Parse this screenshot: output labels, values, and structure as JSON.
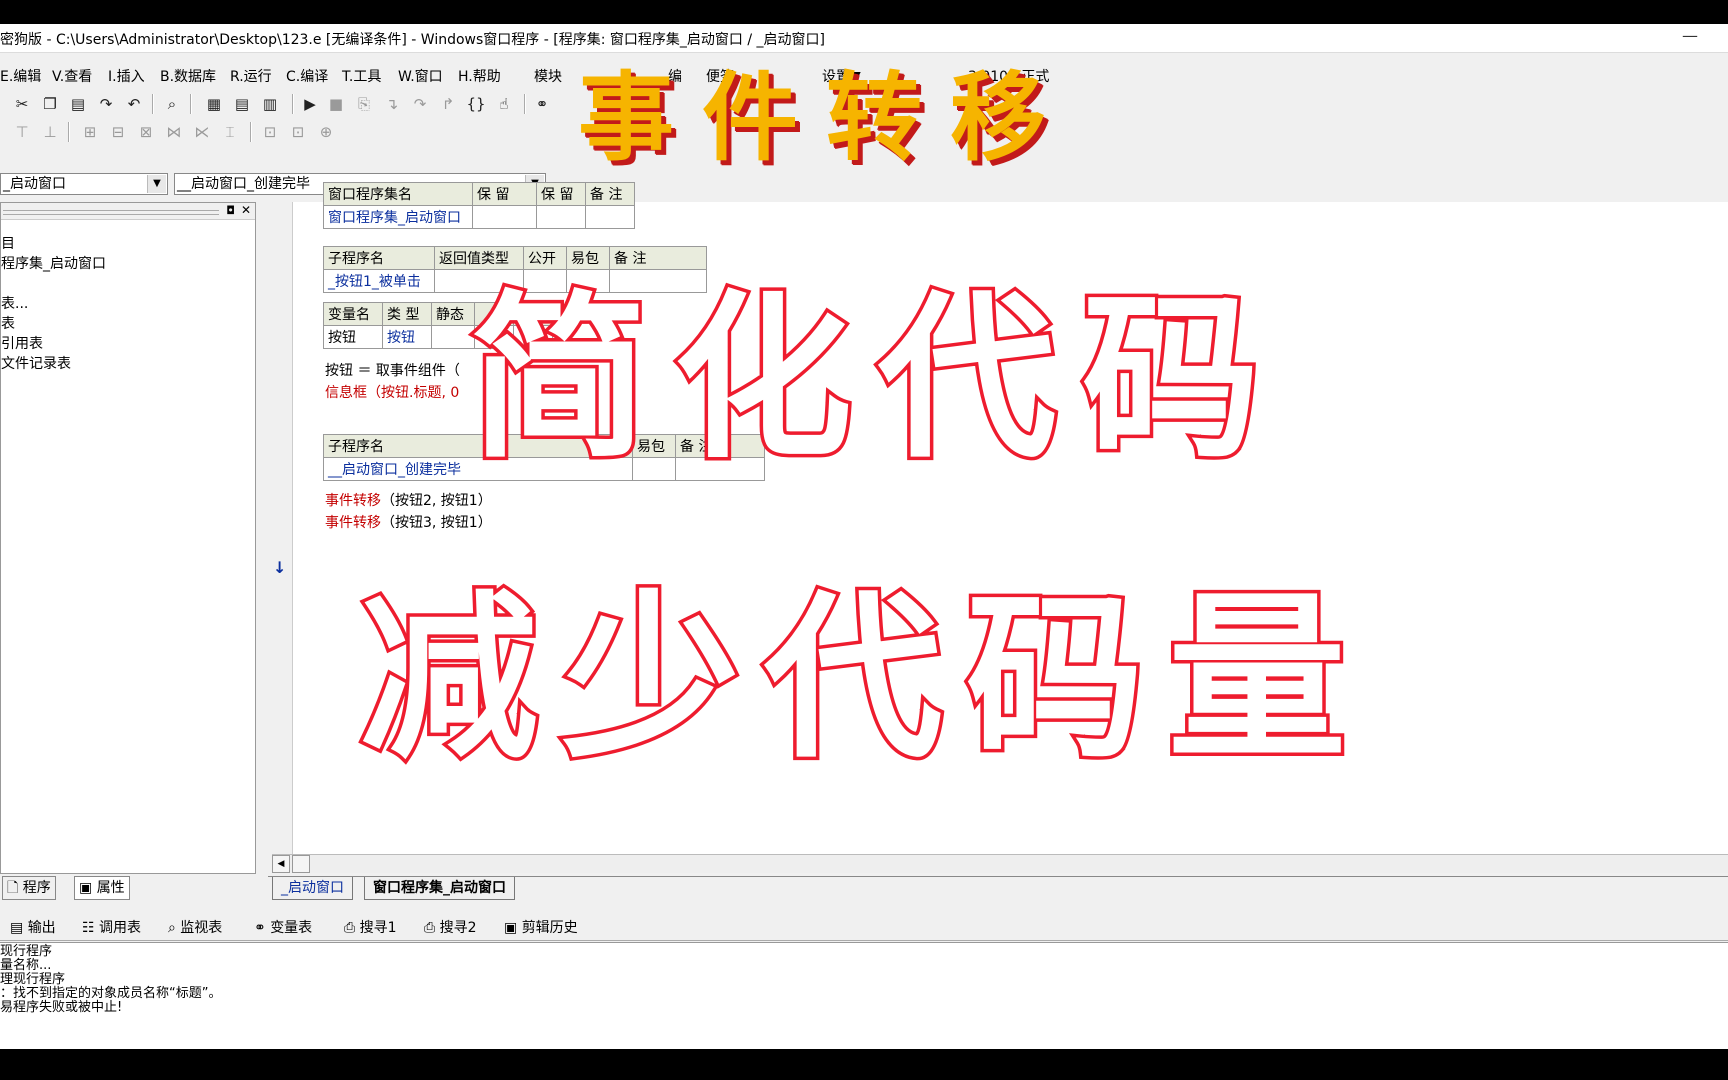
{
  "window": {
    "title": "密狗版 - C:\\Users\\Administrator\\Desktop\\123.e [无编译条件] - Windows窗口程序 - [程序集: 窗口程序集_启动窗口 / _启动窗口]",
    "minimize": "—"
  },
  "menu": [
    "E.编辑",
    "V.查看",
    "I.插入",
    "B.数据库",
    "R.运行",
    "C.编译",
    "T.工具",
    "W.窗口",
    "H.帮助",
    "模块",
    "编",
    "便签",
    "设置▼",
    "3.0101 正式"
  ],
  "selectors": {
    "left": "_启动窗口",
    "right": "__启动窗口_创建完毕"
  },
  "left_panel": {
    "tree": [
      "目",
      "程序集_启动窗口",
      "表...",
      "表",
      "引用表",
      "文件记录表"
    ],
    "tabs": [
      "程序",
      "属性"
    ]
  },
  "code": {
    "assembly_table": {
      "headers": [
        "窗口程序集名",
        "保 留",
        "保 留",
        "备 注"
      ],
      "row": [
        "窗口程序集_启动窗口",
        "",
        "",
        ""
      ]
    },
    "sub1_table": {
      "headers": [
        "子程序名",
        "返回值类型",
        "公开",
        "易包",
        "备 注"
      ],
      "row": [
        "_按钮1_被单击",
        "",
        "",
        "",
        ""
      ]
    },
    "var_table": {
      "headers": [
        "变量名",
        "类 型",
        "静态",
        "",
        "备"
      ],
      "row": [
        "按钮",
        "按钮",
        "",
        "",
        ""
      ]
    },
    "lines1": [
      "按钮 ＝ 取事件组件（",
      "信息框（按钮.标题, 0"
    ],
    "sub2_table": {
      "headers": [
        "子程序名",
        "易包",
        "备 注"
      ],
      "row": [
        "__启动窗口_创建完毕",
        "",
        ""
      ]
    },
    "lines2": [
      {
        "fn": "事件转移",
        "args": "（按钮2, 按钮1）"
      },
      {
        "fn": "事件转移",
        "args": "（按钮3, 按钮1）"
      }
    ],
    "arrow": "↓"
  },
  "doc_tabs": [
    "_启动窗口",
    "窗口程序集_启动窗口"
  ],
  "bottom_tabs": [
    "输出",
    "调用表",
    "监视表",
    "变量表",
    "搜寻1",
    "搜寻2",
    "剪辑历史"
  ],
  "output": [
    "现行程序",
    "量名称...",
    "理现行程序",
    "：找不到指定的对象成员名称“标题”。",
    "易程序失败或被中止!"
  ],
  "overlay": {
    "line1": "事件转移",
    "line2": "简化代码",
    "line3": "减少代码量"
  },
  "colors": {
    "overlay_yellow": "#f6b400",
    "overlay_red": "#ee1c2e",
    "keyword_red": "#c40000",
    "identifier_blue": "#0b2f9e"
  }
}
